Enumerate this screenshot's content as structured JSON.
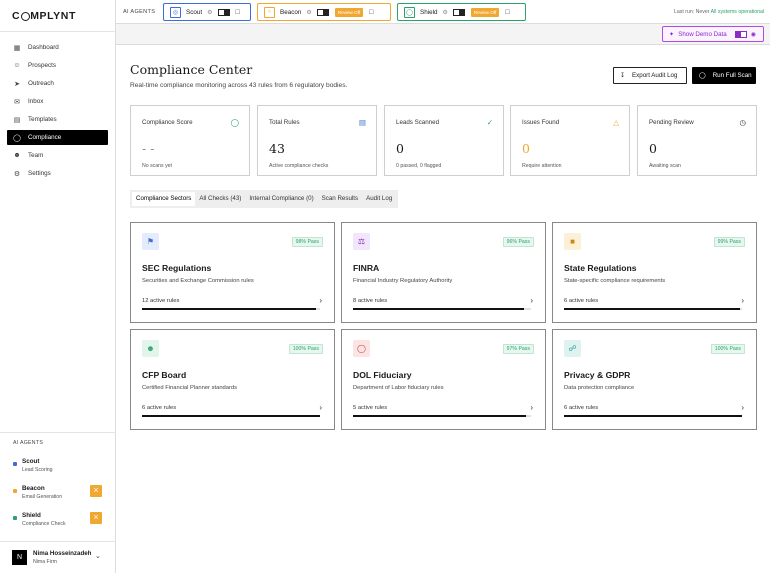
{
  "app": {
    "logo_pre": "C",
    "logo_post": "MPLYNT"
  },
  "sidebar": {
    "nav": [
      {
        "label": "Dashboard",
        "icon": "grid-icon"
      },
      {
        "label": "Prospects",
        "icon": "users-icon"
      },
      {
        "label": "Outreach",
        "icon": "send-icon"
      },
      {
        "label": "Inbox",
        "icon": "inbox-icon"
      },
      {
        "label": "Templates",
        "icon": "document-icon"
      },
      {
        "label": "Compliance",
        "icon": "shield-icon"
      },
      {
        "label": "Team",
        "icon": "team-icon"
      },
      {
        "label": "Settings",
        "icon": "gear-icon"
      }
    ],
    "active": "Compliance",
    "agents_title": "AI AGENTS",
    "agents": [
      {
        "name": "Scout",
        "desc": "Lead Scoring",
        "color": "#3b6fd6"
      },
      {
        "name": "Beacon",
        "desc": "Email Generation",
        "color": "#f0a830"
      },
      {
        "name": "Shield",
        "desc": "Compliance Check",
        "color": "#2aa26b"
      }
    ],
    "user": {
      "initial": "N",
      "name": "Nima Hosseinzadeh",
      "firm": "Nima Firm"
    }
  },
  "topbar": {
    "label": "AI AGENTS",
    "agents": [
      {
        "name": "Scout",
        "review": "",
        "color": "#3b6fd6"
      },
      {
        "name": "Beacon",
        "review": "Review Off",
        "color": "#f0a830"
      },
      {
        "name": "Shield",
        "review": "Review Off",
        "color": "#2aa26b"
      }
    ],
    "last_run_label": "Last run: Never",
    "status": "All systems operational",
    "demo_label": "Show Demo Data"
  },
  "page": {
    "title": "Compliance Center",
    "subtitle": "Real-time compliance monitoring across 43 rules from 6 regulatory bodies.",
    "export_label": "Export Audit Log",
    "scan_label": "Run Full Scan"
  },
  "stats": [
    {
      "label": "Compliance Score",
      "value": "- -",
      "note": "No scans yet",
      "color": "#2aa26b",
      "icon": "shield-icon"
    },
    {
      "label": "Total Rules",
      "value": "43",
      "note": "Active compliance checks",
      "color": "#3b6fd6",
      "icon": "document-icon"
    },
    {
      "label": "Leads Scanned",
      "value": "0",
      "note": "0 passed, 0 flagged",
      "color": "#2aa26b",
      "icon": "check-circle-icon"
    },
    {
      "label": "Issues Found",
      "value": "0",
      "note": "Require attention",
      "color": "#f0a830",
      "icon": "warning-icon"
    },
    {
      "label": "Pending Review",
      "value": "0",
      "note": "Awaiting scan",
      "color": "#333333",
      "icon": "clock-icon"
    }
  ],
  "tabs": [
    "Compliance Sectors",
    "All Checks (43)",
    "Internal Compliance (0)",
    "Scan Results",
    "Audit Log"
  ],
  "sectors": [
    {
      "title": "SEC Regulations",
      "desc": "Securities and Exchange Commission rules",
      "rules": "12 active rules",
      "pass": "98% Pass",
      "pass_pct": 98,
      "icon": "bank-icon",
      "icon_bg": "#e3ebfc",
      "icon_color": "#3b6fd6"
    },
    {
      "title": "FINRA",
      "desc": "Financial Industry Regulatory Authority",
      "rules": "8 active rules",
      "pass": "96% Pass",
      "pass_pct": 96,
      "icon": "scales-icon",
      "icon_bg": "#f1e6fb",
      "icon_color": "#8a2cc4"
    },
    {
      "title": "State Regulations",
      "desc": "State-specific compliance requirements",
      "rules": "6 active rules",
      "pass": "99% Pass",
      "pass_pct": 99,
      "icon": "building-icon",
      "icon_bg": "#fcf0d8",
      "icon_color": "#c98a10"
    },
    {
      "title": "CFP Board",
      "desc": "Certified Financial Planner standards",
      "rules": "6 active rules",
      "pass": "100% Pass",
      "pass_pct": 100,
      "icon": "people-icon",
      "icon_bg": "#e2f5ea",
      "icon_color": "#2aa26b"
    },
    {
      "title": "DOL Fiduciary",
      "desc": "Department of Labor fiduciary rules",
      "rules": "5 active rules",
      "pass": "97% Pass",
      "pass_pct": 97,
      "icon": "shield-icon",
      "icon_bg": "#fbe4e4",
      "icon_color": "#d04040"
    },
    {
      "title": "Privacy & GDPR",
      "desc": "Data protection compliance",
      "rules": "6 active rules",
      "pass": "100% Pass",
      "pass_pct": 100,
      "icon": "globe-icon",
      "icon_bg": "#ddf2f1",
      "icon_color": "#1f9a93"
    }
  ]
}
